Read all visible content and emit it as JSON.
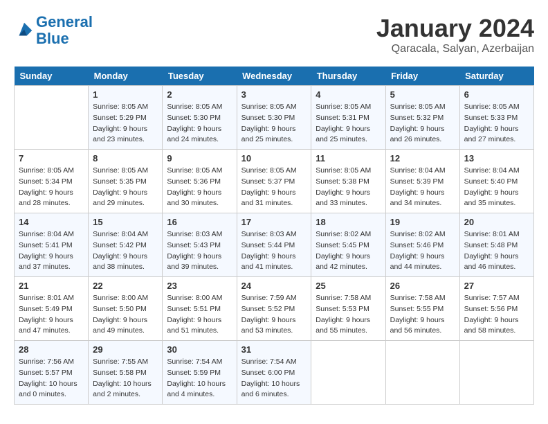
{
  "header": {
    "logo_line1": "General",
    "logo_line2": "Blue",
    "month": "January 2024",
    "location": "Qaracala, Salyan, Azerbaijan"
  },
  "weekdays": [
    "Sunday",
    "Monday",
    "Tuesday",
    "Wednesday",
    "Thursday",
    "Friday",
    "Saturday"
  ],
  "weeks": [
    [
      {
        "num": "",
        "sunrise": "",
        "sunset": "",
        "daylight": ""
      },
      {
        "num": "1",
        "sunrise": "Sunrise: 8:05 AM",
        "sunset": "Sunset: 5:29 PM",
        "daylight": "Daylight: 9 hours and 23 minutes."
      },
      {
        "num": "2",
        "sunrise": "Sunrise: 8:05 AM",
        "sunset": "Sunset: 5:30 PM",
        "daylight": "Daylight: 9 hours and 24 minutes."
      },
      {
        "num": "3",
        "sunrise": "Sunrise: 8:05 AM",
        "sunset": "Sunset: 5:30 PM",
        "daylight": "Daylight: 9 hours and 25 minutes."
      },
      {
        "num": "4",
        "sunrise": "Sunrise: 8:05 AM",
        "sunset": "Sunset: 5:31 PM",
        "daylight": "Daylight: 9 hours and 25 minutes."
      },
      {
        "num": "5",
        "sunrise": "Sunrise: 8:05 AM",
        "sunset": "Sunset: 5:32 PM",
        "daylight": "Daylight: 9 hours and 26 minutes."
      },
      {
        "num": "6",
        "sunrise": "Sunrise: 8:05 AM",
        "sunset": "Sunset: 5:33 PM",
        "daylight": "Daylight: 9 hours and 27 minutes."
      }
    ],
    [
      {
        "num": "7",
        "sunrise": "Sunrise: 8:05 AM",
        "sunset": "Sunset: 5:34 PM",
        "daylight": "Daylight: 9 hours and 28 minutes."
      },
      {
        "num": "8",
        "sunrise": "Sunrise: 8:05 AM",
        "sunset": "Sunset: 5:35 PM",
        "daylight": "Daylight: 9 hours and 29 minutes."
      },
      {
        "num": "9",
        "sunrise": "Sunrise: 8:05 AM",
        "sunset": "Sunset: 5:36 PM",
        "daylight": "Daylight: 9 hours and 30 minutes."
      },
      {
        "num": "10",
        "sunrise": "Sunrise: 8:05 AM",
        "sunset": "Sunset: 5:37 PM",
        "daylight": "Daylight: 9 hours and 31 minutes."
      },
      {
        "num": "11",
        "sunrise": "Sunrise: 8:05 AM",
        "sunset": "Sunset: 5:38 PM",
        "daylight": "Daylight: 9 hours and 33 minutes."
      },
      {
        "num": "12",
        "sunrise": "Sunrise: 8:04 AM",
        "sunset": "Sunset: 5:39 PM",
        "daylight": "Daylight: 9 hours and 34 minutes."
      },
      {
        "num": "13",
        "sunrise": "Sunrise: 8:04 AM",
        "sunset": "Sunset: 5:40 PM",
        "daylight": "Daylight: 9 hours and 35 minutes."
      }
    ],
    [
      {
        "num": "14",
        "sunrise": "Sunrise: 8:04 AM",
        "sunset": "Sunset: 5:41 PM",
        "daylight": "Daylight: 9 hours and 37 minutes."
      },
      {
        "num": "15",
        "sunrise": "Sunrise: 8:04 AM",
        "sunset": "Sunset: 5:42 PM",
        "daylight": "Daylight: 9 hours and 38 minutes."
      },
      {
        "num": "16",
        "sunrise": "Sunrise: 8:03 AM",
        "sunset": "Sunset: 5:43 PM",
        "daylight": "Daylight: 9 hours and 39 minutes."
      },
      {
        "num": "17",
        "sunrise": "Sunrise: 8:03 AM",
        "sunset": "Sunset: 5:44 PM",
        "daylight": "Daylight: 9 hours and 41 minutes."
      },
      {
        "num": "18",
        "sunrise": "Sunrise: 8:02 AM",
        "sunset": "Sunset: 5:45 PM",
        "daylight": "Daylight: 9 hours and 42 minutes."
      },
      {
        "num": "19",
        "sunrise": "Sunrise: 8:02 AM",
        "sunset": "Sunset: 5:46 PM",
        "daylight": "Daylight: 9 hours and 44 minutes."
      },
      {
        "num": "20",
        "sunrise": "Sunrise: 8:01 AM",
        "sunset": "Sunset: 5:48 PM",
        "daylight": "Daylight: 9 hours and 46 minutes."
      }
    ],
    [
      {
        "num": "21",
        "sunrise": "Sunrise: 8:01 AM",
        "sunset": "Sunset: 5:49 PM",
        "daylight": "Daylight: 9 hours and 47 minutes."
      },
      {
        "num": "22",
        "sunrise": "Sunrise: 8:00 AM",
        "sunset": "Sunset: 5:50 PM",
        "daylight": "Daylight: 9 hours and 49 minutes."
      },
      {
        "num": "23",
        "sunrise": "Sunrise: 8:00 AM",
        "sunset": "Sunset: 5:51 PM",
        "daylight": "Daylight: 9 hours and 51 minutes."
      },
      {
        "num": "24",
        "sunrise": "Sunrise: 7:59 AM",
        "sunset": "Sunset: 5:52 PM",
        "daylight": "Daylight: 9 hours and 53 minutes."
      },
      {
        "num": "25",
        "sunrise": "Sunrise: 7:58 AM",
        "sunset": "Sunset: 5:53 PM",
        "daylight": "Daylight: 9 hours and 55 minutes."
      },
      {
        "num": "26",
        "sunrise": "Sunrise: 7:58 AM",
        "sunset": "Sunset: 5:55 PM",
        "daylight": "Daylight: 9 hours and 56 minutes."
      },
      {
        "num": "27",
        "sunrise": "Sunrise: 7:57 AM",
        "sunset": "Sunset: 5:56 PM",
        "daylight": "Daylight: 9 hours and 58 minutes."
      }
    ],
    [
      {
        "num": "28",
        "sunrise": "Sunrise: 7:56 AM",
        "sunset": "Sunset: 5:57 PM",
        "daylight": "Daylight: 10 hours and 0 minutes."
      },
      {
        "num": "29",
        "sunrise": "Sunrise: 7:55 AM",
        "sunset": "Sunset: 5:58 PM",
        "daylight": "Daylight: 10 hours and 2 minutes."
      },
      {
        "num": "30",
        "sunrise": "Sunrise: 7:54 AM",
        "sunset": "Sunset: 5:59 PM",
        "daylight": "Daylight: 10 hours and 4 minutes."
      },
      {
        "num": "31",
        "sunrise": "Sunrise: 7:54 AM",
        "sunset": "Sunset: 6:00 PM",
        "daylight": "Daylight: 10 hours and 6 minutes."
      },
      {
        "num": "",
        "sunrise": "",
        "sunset": "",
        "daylight": ""
      },
      {
        "num": "",
        "sunrise": "",
        "sunset": "",
        "daylight": ""
      },
      {
        "num": "",
        "sunrise": "",
        "sunset": "",
        "daylight": ""
      }
    ]
  ]
}
